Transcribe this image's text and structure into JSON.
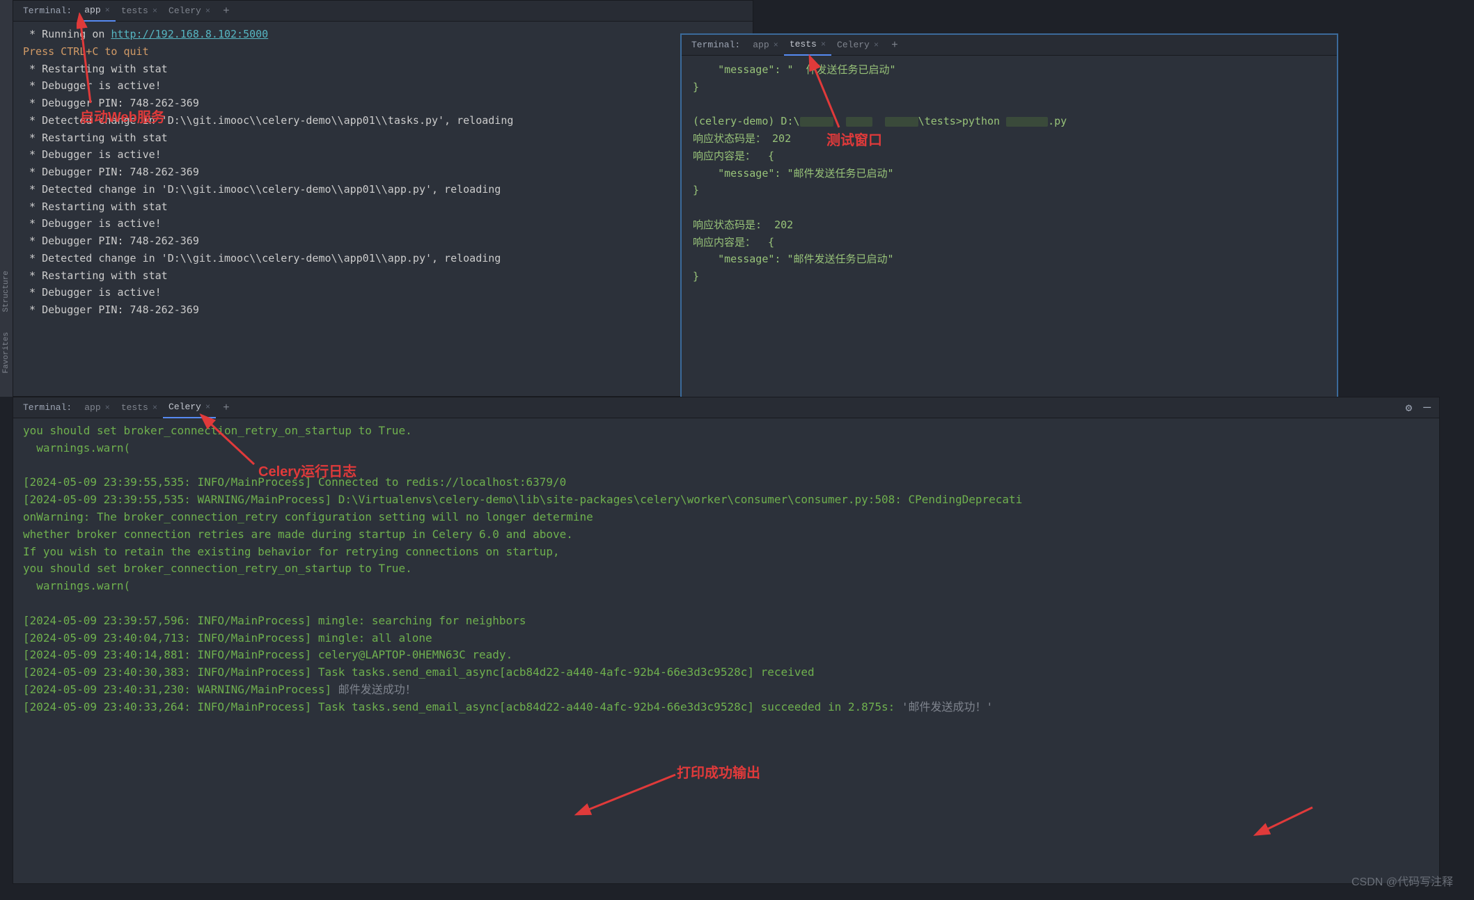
{
  "topLeft": {
    "terminalLabel": "Terminal:",
    "tabs": [
      {
        "label": "app",
        "active": true
      },
      {
        "label": "tests",
        "active": false
      },
      {
        "label": "Celery",
        "active": false
      }
    ],
    "lines": {
      "running": " * Running on ",
      "url": "http://192.168.8.102:5000",
      "quit": "Press CTRL+C to quit",
      "restart": " * Restarting with stat",
      "debugActive": " * Debugger is active!",
      "pin": " * Debugger PIN: 748-262-369",
      "change1": " * Detected change in 'D:\\\\git.imooc\\\\celery-demo\\\\app01\\\\tasks.py', reloading",
      "change2": " * Detected change in 'D:\\\\git.imooc\\\\celery-demo\\\\app01\\\\app.py', reloading"
    }
  },
  "topRight": {
    "terminalLabel": "Terminal:",
    "tabs": [
      {
        "label": "app",
        "active": false
      },
      {
        "label": "tests",
        "active": true
      },
      {
        "label": "Celery",
        "active": false
      }
    ],
    "msgKey": "    \"message\"",
    "msgVal": "\"邮件发送任务已启动\"",
    "msgValPartial": "\"  件发送任务已启动\"",
    "brace": "}",
    "prompt1": "(celery-demo) D:\\",
    "promptMid": "\\tests>python ",
    "promptEnd": ".py",
    "status": "响应状态码是： 202",
    "content": "响应内容是：  {",
    "statusB": "响应状态码是:  202",
    "contentB": "响应内容是：  {"
  },
  "bottom": {
    "terminalLabel": "Terminal:",
    "tabs": [
      {
        "label": "app",
        "active": false
      },
      {
        "label": "tests",
        "active": false
      },
      {
        "label": "Celery",
        "active": true
      }
    ],
    "l1": "you should set broker_connection_retry_on_startup to True.",
    "l2": "  warnings.warn(",
    "l3": "[2024-05-09 23:39:55,535: INFO/MainProcess] Connected to redis://localhost:6379/0",
    "l4": "[2024-05-09 23:39:55,535: WARNING/MainProcess] D:\\Virtualenvs\\celery-demo\\lib\\site-packages\\celery\\worker\\consumer\\consumer.py:508: CPendingDeprecati",
    "l5": "onWarning: The broker_connection_retry configuration setting will no longer determine",
    "l6": "whether broker connection retries are made during startup in Celery 6.0 and above.",
    "l7": "If you wish to retain the existing behavior for retrying connections on startup,",
    "l8": "you should set broker_connection_retry_on_startup to True.",
    "l9": "  warnings.warn(",
    "l10": "[2024-05-09 23:39:57,596: INFO/MainProcess] mingle: searching for neighbors",
    "l11": "[2024-05-09 23:40:04,713: INFO/MainProcess] mingle: all alone",
    "l12": "[2024-05-09 23:40:14,881: INFO/MainProcess] celery@LAPTOP-0HEMN63C ready.",
    "l13": "[2024-05-09 23:40:30,383: INFO/MainProcess] Task tasks.send_email_async[acb84d22-a440-4afc-92b4-66e3d3c9528c] received",
    "l14a": "[2024-05-09 23:40:31,230: WARNING/MainProcess] ",
    "l14b": "邮件发送成功！",
    "l15a": "[2024-05-09 23:40:33,264: INFO/MainProcess] Task tasks.send_email_async[acb84d22-a440-4afc-92b4-66e3d3c9528c] succeeded in 2.875s: ",
    "l15b": "'邮件发送成功！'"
  },
  "annotations": {
    "a1": "启动Web服务",
    "a2": "测试窗口",
    "a3": "Celery运行日志",
    "a4": "打印成功输出"
  },
  "sidebar": {
    "fav": "Favorites",
    "struct": "Structure"
  },
  "watermark": "CSDN @代码写注释"
}
